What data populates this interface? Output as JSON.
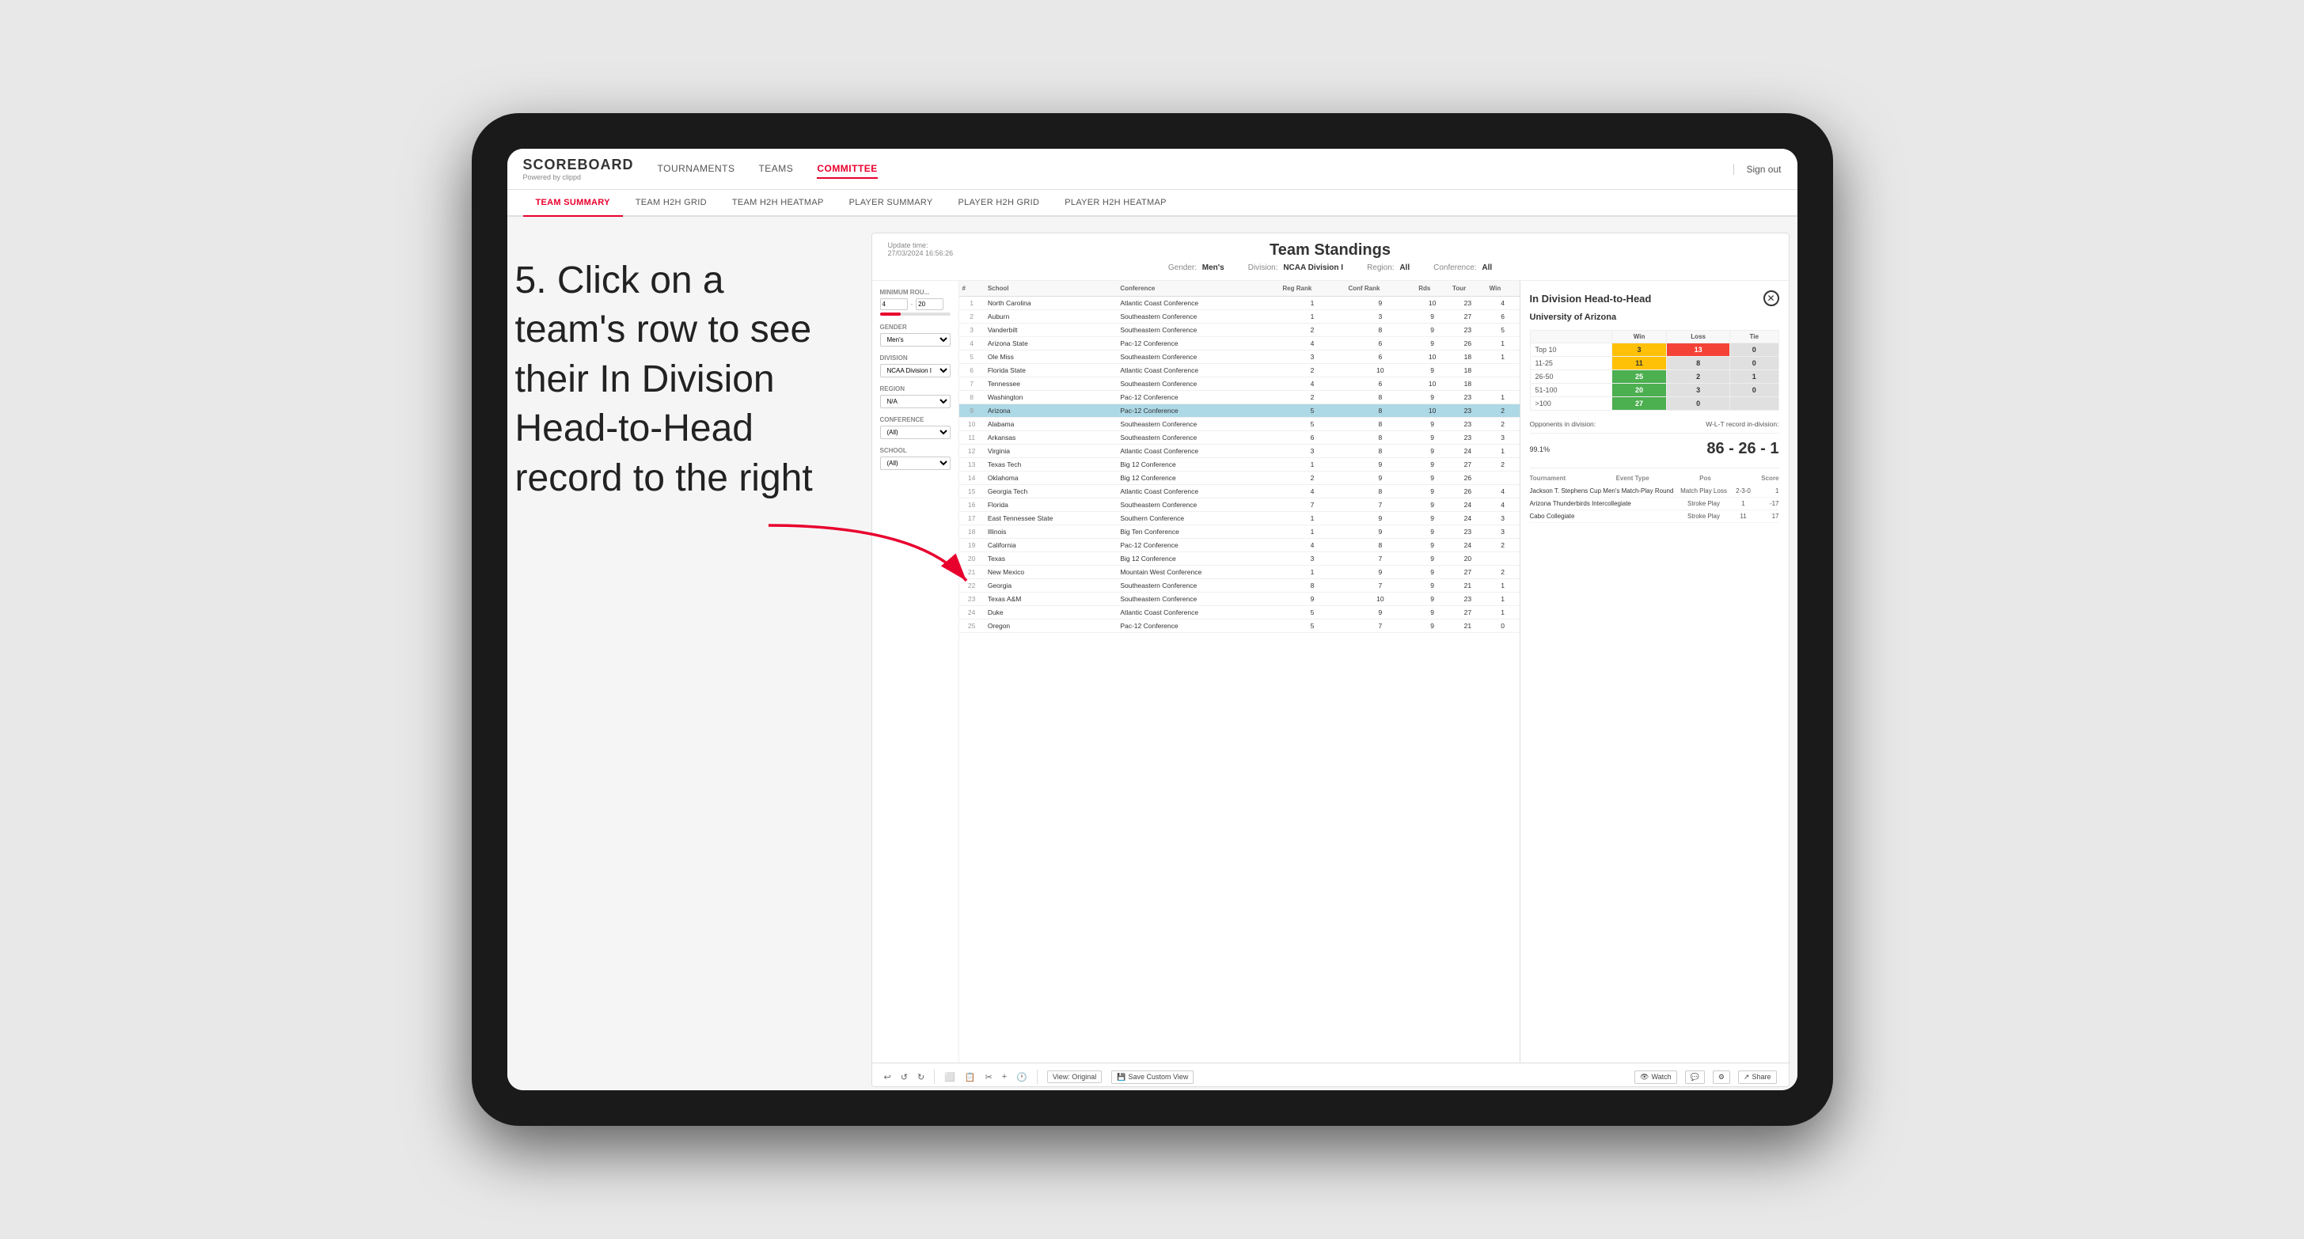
{
  "app": {
    "logo": "SCOREBOARD",
    "logo_sub": "Powered by clippd",
    "nav_items": [
      "TOURNAMENTS",
      "TEAMS",
      "COMMITTEE"
    ],
    "active_nav": "COMMITTEE",
    "sign_out": "Sign out",
    "sub_nav": [
      "TEAM SUMMARY",
      "TEAM H2H GRID",
      "TEAM H2H HEATMAP",
      "PLAYER SUMMARY",
      "PLAYER H2H GRID",
      "PLAYER H2H HEATMAP"
    ],
    "active_sub_nav": "PLAYER SUMMARY"
  },
  "annotation": {
    "text": "5. Click on a team's row to see their In Division Head-to-Head record to the right"
  },
  "panel": {
    "title": "Team Standings",
    "update_label": "Update time:",
    "update_time": "27/03/2024 16:56:26",
    "gender_label": "Gender:",
    "gender_value": "Men's",
    "division_label": "Division:",
    "division_value": "NCAA Division I",
    "region_label": "Region:",
    "region_value": "All",
    "conference_label": "Conference:",
    "conference_value": "All"
  },
  "filters": {
    "minimum_rounds_label": "Minimum Rou...",
    "min_val": "4",
    "max_val": "20",
    "gender_label": "Gender",
    "gender_value": "Men's",
    "division_label": "Division",
    "division_value": "NCAA Division I",
    "region_label": "Region",
    "region_value": "N/A",
    "conference_label": "Conference",
    "conference_value": "(All)",
    "school_label": "School",
    "school_value": "(All)"
  },
  "table": {
    "headers": [
      "#",
      "School",
      "Conference",
      "Reg Rank",
      "Conf Rank",
      "Rds",
      "Tour",
      "Win"
    ],
    "rows": [
      {
        "rank": 1,
        "school": "North Carolina",
        "conference": "Atlantic Coast Conference",
        "reg_rank": "1",
        "conf_rank": "9",
        "rds": "10",
        "tour": "23",
        "win": "4"
      },
      {
        "rank": 2,
        "school": "Auburn",
        "conference": "Southeastern Conference",
        "reg_rank": "1",
        "conf_rank": "3",
        "rds": "9",
        "tour": "27",
        "win": "6"
      },
      {
        "rank": 3,
        "school": "Vanderbilt",
        "conference": "Southeastern Conference",
        "reg_rank": "2",
        "conf_rank": "8",
        "rds": "9",
        "tour": "23",
        "win": "5"
      },
      {
        "rank": 4,
        "school": "Arizona State",
        "conference": "Pac-12 Conference",
        "reg_rank": "4",
        "conf_rank": "6",
        "rds": "9",
        "tour": "26",
        "win": "1"
      },
      {
        "rank": 5,
        "school": "Ole Miss",
        "conference": "Southeastern Conference",
        "reg_rank": "3",
        "conf_rank": "6",
        "rds": "10",
        "tour": "18",
        "win": "1"
      },
      {
        "rank": 6,
        "school": "Florida State",
        "conference": "Atlantic Coast Conference",
        "reg_rank": "2",
        "conf_rank": "10",
        "rds": "9",
        "tour": "18",
        "win": ""
      },
      {
        "rank": 7,
        "school": "Tennessee",
        "conference": "Southeastern Conference",
        "reg_rank": "4",
        "conf_rank": "6",
        "rds": "10",
        "tour": "18",
        "win": ""
      },
      {
        "rank": 8,
        "school": "Washington",
        "conference": "Pac-12 Conference",
        "reg_rank": "2",
        "conf_rank": "8",
        "rds": "9",
        "tour": "23",
        "win": "1"
      },
      {
        "rank": 9,
        "school": "Arizona",
        "conference": "Pac-12 Conference",
        "reg_rank": "5",
        "conf_rank": "8",
        "rds": "10",
        "tour": "23",
        "win": "2",
        "selected": true
      },
      {
        "rank": 10,
        "school": "Alabama",
        "conference": "Southeastern Conference",
        "reg_rank": "5",
        "conf_rank": "8",
        "rds": "9",
        "tour": "23",
        "win": "2"
      },
      {
        "rank": 11,
        "school": "Arkansas",
        "conference": "Southeastern Conference",
        "reg_rank": "6",
        "conf_rank": "8",
        "rds": "9",
        "tour": "23",
        "win": "3"
      },
      {
        "rank": 12,
        "school": "Virginia",
        "conference": "Atlantic Coast Conference",
        "reg_rank": "3",
        "conf_rank": "8",
        "rds": "9",
        "tour": "24",
        "win": "1"
      },
      {
        "rank": 13,
        "school": "Texas Tech",
        "conference": "Big 12 Conference",
        "reg_rank": "1",
        "conf_rank": "9",
        "rds": "9",
        "tour": "27",
        "win": "2"
      },
      {
        "rank": 14,
        "school": "Oklahoma",
        "conference": "Big 12 Conference",
        "reg_rank": "2",
        "conf_rank": "9",
        "rds": "9",
        "tour": "26",
        "win": ""
      },
      {
        "rank": 15,
        "school": "Georgia Tech",
        "conference": "Atlantic Coast Conference",
        "reg_rank": "4",
        "conf_rank": "8",
        "rds": "9",
        "tour": "26",
        "win": "4"
      },
      {
        "rank": 16,
        "school": "Florida",
        "conference": "Southeastern Conference",
        "reg_rank": "7",
        "conf_rank": "7",
        "rds": "9",
        "tour": "24",
        "win": "4"
      },
      {
        "rank": 17,
        "school": "East Tennessee State",
        "conference": "Southern Conference",
        "reg_rank": "1",
        "conf_rank": "9",
        "rds": "9",
        "tour": "24",
        "win": "3"
      },
      {
        "rank": 18,
        "school": "Illinois",
        "conference": "Big Ten Conference",
        "reg_rank": "1",
        "conf_rank": "9",
        "rds": "9",
        "tour": "23",
        "win": "3"
      },
      {
        "rank": 19,
        "school": "California",
        "conference": "Pac-12 Conference",
        "reg_rank": "4",
        "conf_rank": "8",
        "rds": "9",
        "tour": "24",
        "win": "2"
      },
      {
        "rank": 20,
        "school": "Texas",
        "conference": "Big 12 Conference",
        "reg_rank": "3",
        "conf_rank": "7",
        "rds": "9",
        "tour": "20",
        "win": ""
      },
      {
        "rank": 21,
        "school": "New Mexico",
        "conference": "Mountain West Conference",
        "reg_rank": "1",
        "conf_rank": "9",
        "rds": "9",
        "tour": "27",
        "win": "2"
      },
      {
        "rank": 22,
        "school": "Georgia",
        "conference": "Southeastern Conference",
        "reg_rank": "8",
        "conf_rank": "7",
        "rds": "9",
        "tour": "21",
        "win": "1"
      },
      {
        "rank": 23,
        "school": "Texas A&M",
        "conference": "Southeastern Conference",
        "reg_rank": "9",
        "conf_rank": "10",
        "rds": "9",
        "tour": "23",
        "win": "1"
      },
      {
        "rank": 24,
        "school": "Duke",
        "conference": "Atlantic Coast Conference",
        "reg_rank": "5",
        "conf_rank": "9",
        "rds": "9",
        "tour": "27",
        "win": "1"
      },
      {
        "rank": 25,
        "school": "Oregon",
        "conference": "Pac-12 Conference",
        "reg_rank": "5",
        "conf_rank": "7",
        "rds": "9",
        "tour": "21",
        "win": "0"
      }
    ]
  },
  "h2h": {
    "title": "In Division Head-to-Head",
    "team": "University of Arizona",
    "headers": [
      "Win",
      "Loss",
      "Tie"
    ],
    "rows": [
      {
        "label": "Top 10",
        "win": "3",
        "loss": "13",
        "tie": "0",
        "win_class": "cell-yellow",
        "loss_class": "cell-red"
      },
      {
        "label": "11-25",
        "win": "11",
        "loss": "8",
        "tie": "0",
        "win_class": "cell-yellow",
        "loss_class": "cell-gray"
      },
      {
        "label": "26-50",
        "win": "25",
        "loss": "2",
        "tie": "1",
        "win_class": "cell-green",
        "loss_class": "cell-gray"
      },
      {
        "label": "51-100",
        "win": "20",
        "loss": "3",
        "tie": "0",
        "win_class": "cell-green",
        "loss_class": "cell-gray"
      },
      {
        "label": ">100",
        "win": "27",
        "loss": "0",
        "tie": "",
        "win_class": "cell-green",
        "loss_class": "cell-gray"
      }
    ],
    "opponents_label": "Opponents in division:",
    "opponents_value": "99.1%",
    "record_label": "W-L-T record in-division:",
    "record_value": "86 - 26 - 1",
    "tournament_label": "Tournament",
    "event_type_label": "Event Type",
    "pos_label": "Pos",
    "score_label": "Score",
    "tournaments": [
      {
        "name": "Jackson T. Stephens Cup Men's Match-Play Round",
        "event_type": "Match Play",
        "result": "Loss",
        "pos": "2-3-0",
        "score": "1"
      },
      {
        "name": "Arizona Thunderbirds Intercollegiate",
        "event_type": "Stroke Play",
        "pos": "1",
        "score": "-17"
      },
      {
        "name": "Cabo Collegiate",
        "event_type": "Stroke Play",
        "pos": "11",
        "score": "17"
      }
    ]
  },
  "toolbar": {
    "undo": "↩",
    "redo_back": "↺",
    "redo": "↻",
    "view_original": "View: Original",
    "save_custom": "Save Custom View",
    "watch": "Watch",
    "share": "Share"
  }
}
